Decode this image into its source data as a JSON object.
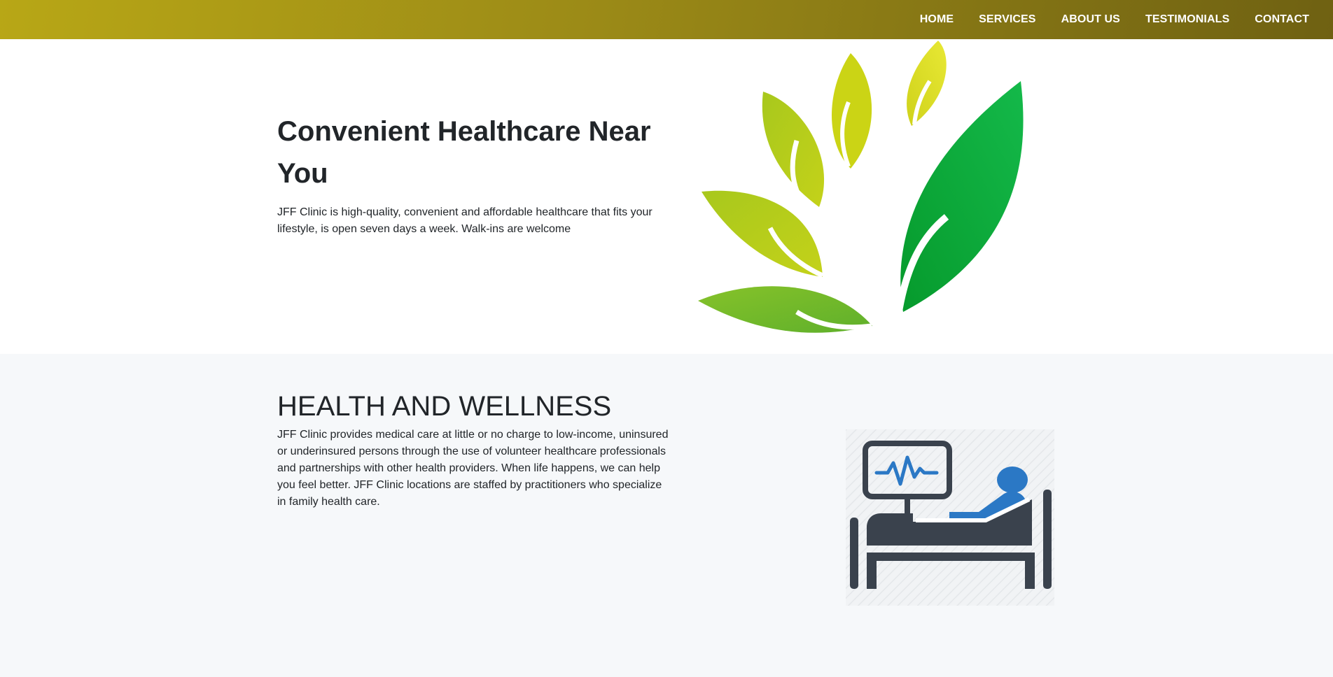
{
  "nav": {
    "items": [
      {
        "label": "HOME"
      },
      {
        "label": "SERVICES"
      },
      {
        "label": "ABOUT US"
      },
      {
        "label": "TESTIMONIALS"
      },
      {
        "label": "CONTACT"
      }
    ]
  },
  "hero": {
    "title": "Convenient Healthcare Near You",
    "text": "JFF Clinic is high-quality, convenient and affordable healthcare that fits your lifestyle, is open seven days a week. Walk-ins are welcome",
    "image_icon": "leaves-logo-icon"
  },
  "wellness": {
    "title": "HEALTH AND WELLNESS",
    "text": "JFF Clinic provides medical care at little or no charge to low-income, uninsured or underinsured persons through the use of volunteer healthcare professionals and partnerships with other health providers. When life happens, we can help you feel better. JFF Clinic locations are staffed by practitioners who specialize in family health care.",
    "image_icon": "hospital-patient-icon"
  },
  "colors": {
    "nav_gradient_start": "#b8a716",
    "nav_gradient_end": "#6f6112",
    "nav_text": "#ffffff",
    "hero_bg": "#ffffff",
    "section_bg": "#f6f8fa",
    "text": "#212529",
    "leaf_dark_green": "#08a533",
    "leaf_lime": "#a8c81c",
    "leaf_yellow": "#d8dc1e",
    "icon_dark": "#3a424d",
    "icon_blue": "#2b78c5"
  }
}
